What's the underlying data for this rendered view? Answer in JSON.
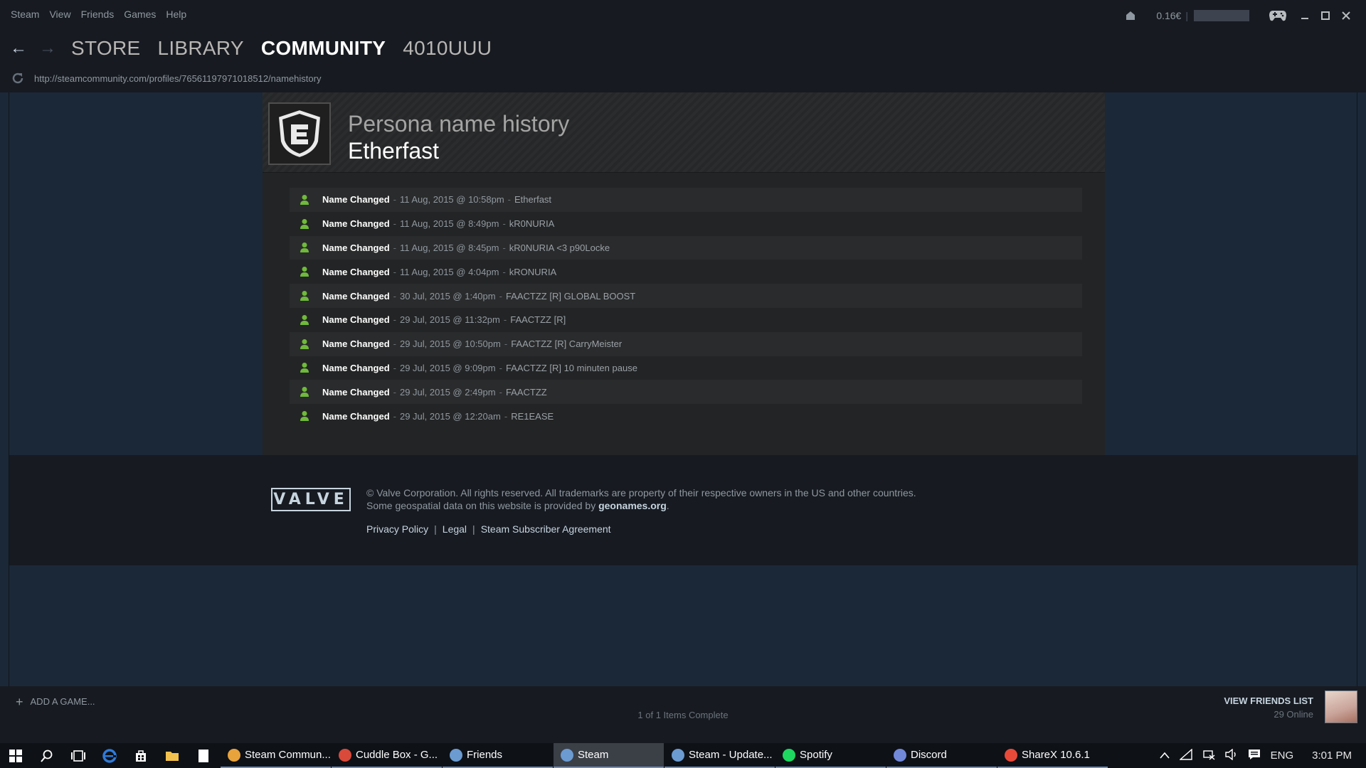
{
  "menu": [
    "Steam",
    "View",
    "Friends",
    "Games",
    "Help"
  ],
  "wallet": "0.16€",
  "nav": {
    "back": "←",
    "forward": "→",
    "links": [
      "STORE",
      "LIBRARY",
      "COMMUNITY",
      "4010UUU"
    ],
    "active": "COMMUNITY"
  },
  "url": "http://steamcommunity.com/profiles/76561197971018512/namehistory",
  "page": {
    "title": "Persona name history",
    "persona": "Etherfast"
  },
  "history": [
    {
      "label": "Name Changed",
      "date": "11 Aug, 2015 @ 10:58pm",
      "name": "Etherfast"
    },
    {
      "label": "Name Changed",
      "date": "11 Aug, 2015 @ 8:49pm",
      "name": "kR0NURIA"
    },
    {
      "label": "Name Changed",
      "date": "11 Aug, 2015 @ 8:45pm",
      "name": "kR0NURIA <3 p90Locke"
    },
    {
      "label": "Name Changed",
      "date": "11 Aug, 2015 @ 4:04pm",
      "name": "kRONURIA"
    },
    {
      "label": "Name Changed",
      "date": "30 Jul, 2015 @ 1:40pm",
      "name": "FAACTZZ [R] GLOBAL BOOST"
    },
    {
      "label": "Name Changed",
      "date": "29 Jul, 2015 @ 11:32pm",
      "name": "FAACTZZ [R]"
    },
    {
      "label": "Name Changed",
      "date": "29 Jul, 2015 @ 10:50pm",
      "name": "FAACTZZ [R] CarryMeister"
    },
    {
      "label": "Name Changed",
      "date": "29 Jul, 2015 @ 9:09pm",
      "name": "FAACTZZ [R] 10 minuten pause"
    },
    {
      "label": "Name Changed",
      "date": "29 Jul, 2015 @ 2:49pm",
      "name": "FAACTZZ"
    },
    {
      "label": "Name Changed",
      "date": "29 Jul, 2015 @ 12:20am",
      "name": "RE1EASE"
    }
  ],
  "footer": {
    "logo": "VALVE",
    "copyright_line1": "© Valve Corporation. All rights reserved. All trademarks are property of their respective owners in the US and other countries.",
    "copyright_line2_prefix": "Some geospatial data on this website is provided by ",
    "copyright_line2_link": "geonames.org",
    "copyright_line2_suffix": ".",
    "links": [
      "Privacy Policy",
      "Legal",
      "Steam Subscriber Agreement"
    ],
    "link_separator": "|"
  },
  "bottom": {
    "add_game": "ADD A GAME...",
    "add_game_icon": "+",
    "items_complete": "1 of 1 Items Complete",
    "friends_label": "VIEW FRIENDS LIST",
    "friends_online": "29 Online"
  },
  "taskbar": {
    "apps": [
      {
        "label": "Steam Commun...",
        "icon": "chrome-icon",
        "color": "#e8a33c",
        "active": false
      },
      {
        "label": "Cuddle Box - G...",
        "icon": "code-icon",
        "color": "#d94a3a",
        "active": false
      },
      {
        "label": "Friends",
        "icon": "steam-icon",
        "color": "#6b9bd1",
        "active": false
      },
      {
        "label": "Steam",
        "icon": "steam-icon",
        "color": "#6b9bd1",
        "active": true
      },
      {
        "label": "Steam - Update...",
        "icon": "steam-icon",
        "color": "#6b9bd1",
        "active": false
      },
      {
        "label": "Spotify",
        "icon": "spotify-icon",
        "color": "#1ed760",
        "active": false
      },
      {
        "label": "Discord",
        "icon": "discord-icon",
        "color": "#7289da",
        "active": false
      },
      {
        "label": "ShareX 10.6.1",
        "icon": "sharex-icon",
        "color": "#e84a3a",
        "active": false
      }
    ],
    "lang": "ENG",
    "time": "3:01 PM"
  },
  "colors": {
    "accent_green": "#6fba3a",
    "background": "#1b2838",
    "chrome": "#171a21"
  }
}
